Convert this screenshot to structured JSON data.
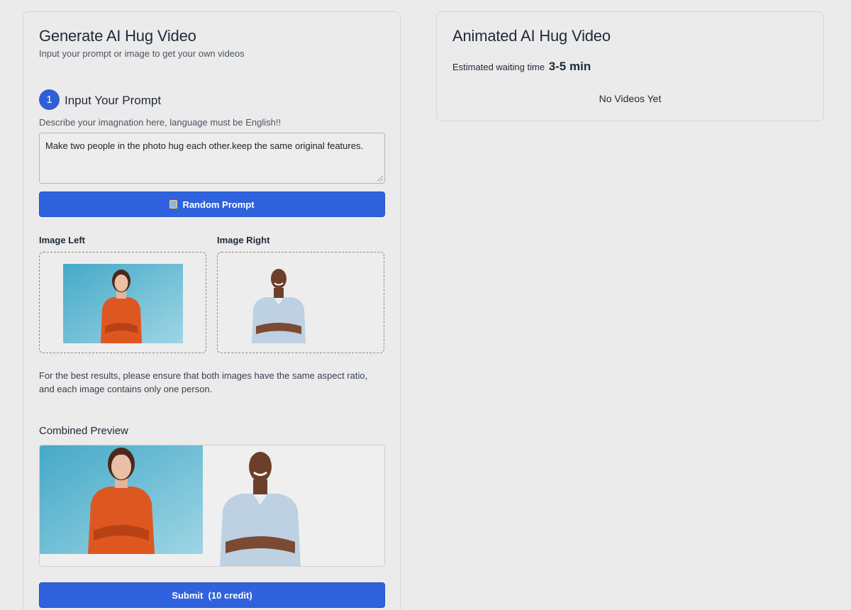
{
  "generator": {
    "title": "Generate AI Hug Video",
    "subtitle": "Input your prompt or image to get your own videos",
    "step_number": "1",
    "step_title": "Input Your Prompt",
    "prompt_hint": "Describe your imagnation here, language must be English!!",
    "prompt_value": "Make two people in the photo hug each other.keep the same original features.",
    "random_button_label": "Random Prompt",
    "image_left_label": "Image Left",
    "image_right_label": "Image Right",
    "aspect_note": "For the best results, please ensure that both images have the same aspect ratio, and each image contains only one person.",
    "preview_title": "Combined Preview",
    "submit_label": "Submit  (10 credit)"
  },
  "result": {
    "title": "Animated AI Hug Video",
    "wait_label": "Estimated waiting time",
    "wait_value": "3-5 min",
    "empty_text": "No Videos Yet"
  },
  "colors": {
    "accent": "#2f62dc",
    "background": "#ebebeb",
    "photo_bg_blue": "#62b8d2",
    "woman_shirt": "#e0561e",
    "man_shirt": "#b9cfe0"
  },
  "icons": {
    "random": "dice-icon"
  }
}
